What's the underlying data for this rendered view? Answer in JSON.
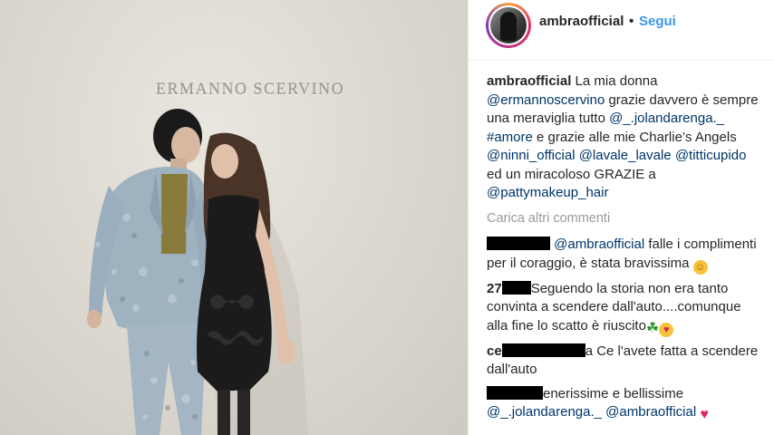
{
  "photo": {
    "sign_text": "ERMANNO SCERVINO"
  },
  "header": {
    "username": "ambraofficial",
    "separator": "•",
    "follow_label": "Segui"
  },
  "caption": {
    "username": "ambraofficial",
    "t1": " La mia donna ",
    "m1": "@ermannoscervino",
    "t2": " grazie davvero è sempre una meraviglia tutto ",
    "m2": "@_.jolandarenga._",
    "t3": " ",
    "m3": "#amore",
    "t4": " e grazie alle mie Charlie’s Angels ",
    "m4": "@ninni_official",
    "t5": " ",
    "m5": "@lavale_lavale",
    "t6": " ",
    "m6": "@titticupido",
    "t7": " ed un miracoloso GRAZIE a ",
    "m7": "@pattymakeup_hair"
  },
  "load_more_label": "Carica altri commenti",
  "comments": [
    {
      "mention": "@ambraofficial",
      "text": " falle i complimenti per il coraggio, è stata bravissima ",
      "emoji": "smiling-face"
    },
    {
      "visible_username_fragment": "27",
      "text": "Seguendo la storia non era tanto convinta a scendere dall'auto....comunque alla fine lo scatto è riuscito",
      "emoji": "four-leaf-clover, kissing-face"
    },
    {
      "visible_username_fragment": "ce",
      "text_fragment": "a",
      "text": " Ce l'avete fatta a scendere dall'auto"
    },
    {
      "text": "enerissime e bellissime",
      "mention1": "@_.jolandarenga._",
      "mention2": "@ambraofficial",
      "emoji": "red-heart"
    }
  ],
  "colors": {
    "link": "#003569",
    "follow": "#3897f0",
    "muted": "#999999",
    "text": "#262626"
  }
}
